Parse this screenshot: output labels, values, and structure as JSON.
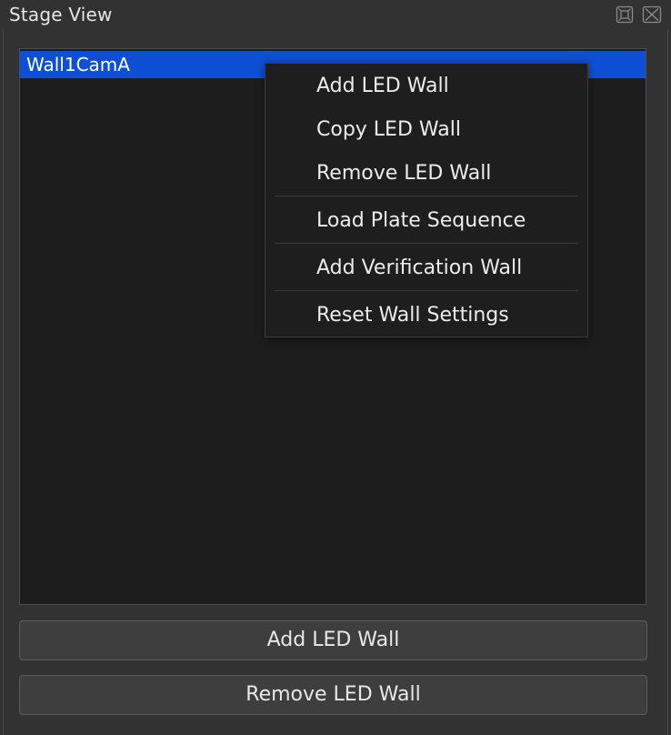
{
  "window": {
    "title": "Stage View",
    "float_icon": "float-icon",
    "close_icon": "close-icon"
  },
  "list": {
    "items": [
      {
        "label": "Wall1CamA",
        "selected": true
      }
    ],
    "selection_color": "#0f4fd6"
  },
  "context_menu": {
    "items": [
      {
        "label": "Add LED Wall"
      },
      {
        "label": "Copy LED Wall"
      },
      {
        "label": "Remove LED Wall"
      },
      {
        "label": "Load Plate Sequence"
      },
      {
        "label": "Add Verification Wall"
      },
      {
        "label": "Reset Wall Settings"
      }
    ]
  },
  "buttons": {
    "add_label": "Add LED Wall",
    "remove_label": "Remove LED Wall"
  }
}
